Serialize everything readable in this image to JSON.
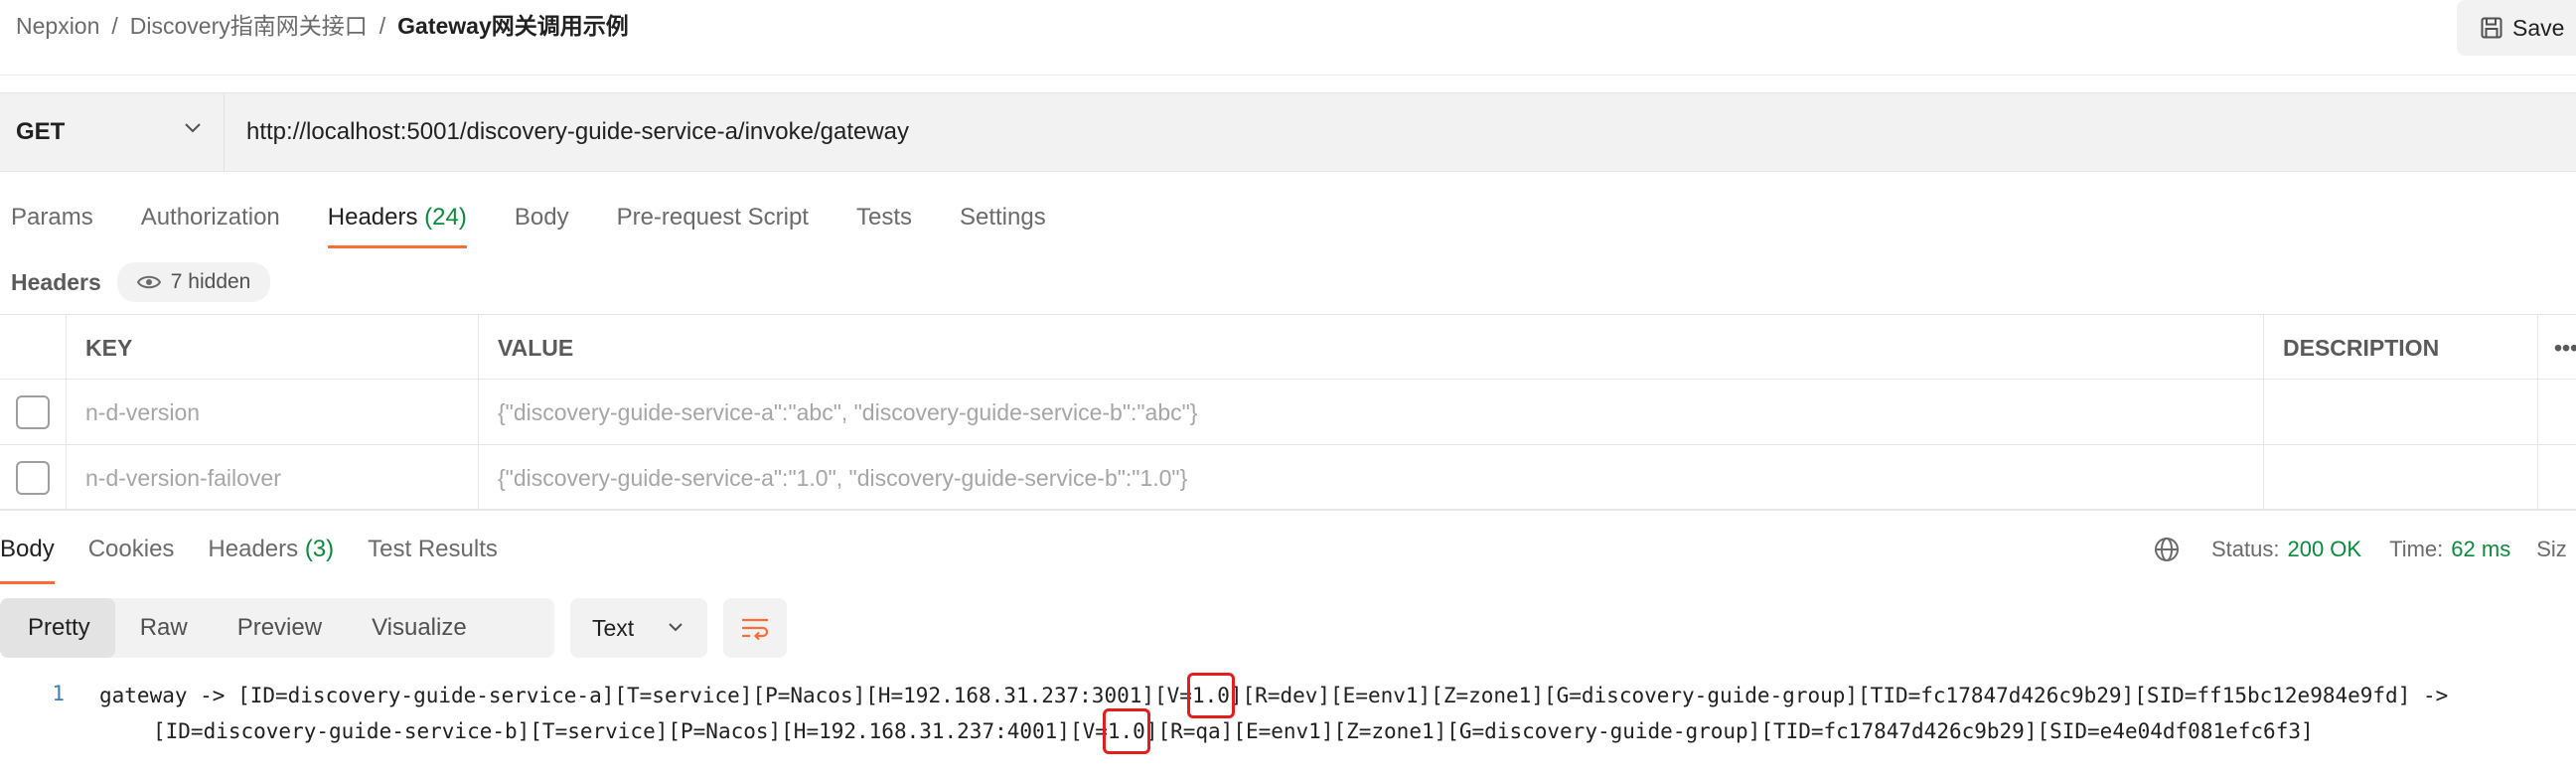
{
  "breadcrumb": {
    "workspace": "Nepxion",
    "collection": "Discovery指南网关接口",
    "request": "Gateway网关调用示例",
    "separator": "/"
  },
  "toolbar": {
    "save_label": "Save",
    "save_icon": "save-icon"
  },
  "request": {
    "method": "GET",
    "url": "http://localhost:5001/discovery-guide-service-a/invoke/gateway"
  },
  "request_tabs": [
    {
      "label": "Params"
    },
    {
      "label": "Authorization"
    },
    {
      "label": "Headers",
      "count": "(24)",
      "active": true
    },
    {
      "label": "Body"
    },
    {
      "label": "Pre-request Script"
    },
    {
      "label": "Tests"
    },
    {
      "label": "Settings"
    }
  ],
  "headers_section": {
    "title": "Headers",
    "hidden_label": "7 hidden",
    "hidden_icon": "eye-icon"
  },
  "headers_table": {
    "columns": {
      "key": "KEY",
      "value": "VALUE",
      "description": "DESCRIPTION",
      "more": "•••"
    },
    "rows": [
      {
        "key": "n-d-version",
        "value": "{\"discovery-guide-service-a\":\"abc\", \"discovery-guide-service-b\":\"abc\"}",
        "checked": false
      },
      {
        "key": "n-d-version-failover",
        "value": "{\"discovery-guide-service-a\":\"1.0\", \"discovery-guide-service-b\":\"1.0\"}",
        "checked": false
      }
    ]
  },
  "response_tabs": [
    {
      "label": "Body",
      "active": true
    },
    {
      "label": "Cookies"
    },
    {
      "label": "Headers",
      "count": "(3)"
    },
    {
      "label": "Test Results"
    }
  ],
  "response_status": {
    "status_label": "Status:",
    "status_value": "200 OK",
    "time_label": "Time:",
    "time_value": "62 ms",
    "size_label": "Siz"
  },
  "view_modes": [
    {
      "label": "Pretty",
      "active": true
    },
    {
      "label": "Raw"
    },
    {
      "label": "Preview"
    },
    {
      "label": "Visualize"
    }
  ],
  "format_select": {
    "value": "Text"
  },
  "response_body": {
    "line_number": "1",
    "line1_prefix": "gateway -> [ID=discovery-guide-service-a][T=service][P=Nacos][H=192.168.31.237:3001][V=",
    "line1_highlight": "1.0",
    "line1_suffix": "][R=dev][E=env1][Z=zone1][G=discovery-guide-group][TID=fc17847d426c9b29][SID=ff15bc12e984e9fd] ->",
    "line2_prefix": "[ID=discovery-guide-service-b][T=service][P=Nacos][H=192.168.31.237:4001][V=",
    "line2_highlight": "1.0",
    "line2_suffix": "][R=qa][E=env1][Z=zone1][G=discovery-guide-group][TID=fc17847d426c9b29][SID=e4e04df081efc6f3]"
  },
  "colors": {
    "accent": "#ff6c37",
    "success": "#0b8a3c",
    "highlight_box": "#e41e1e"
  }
}
